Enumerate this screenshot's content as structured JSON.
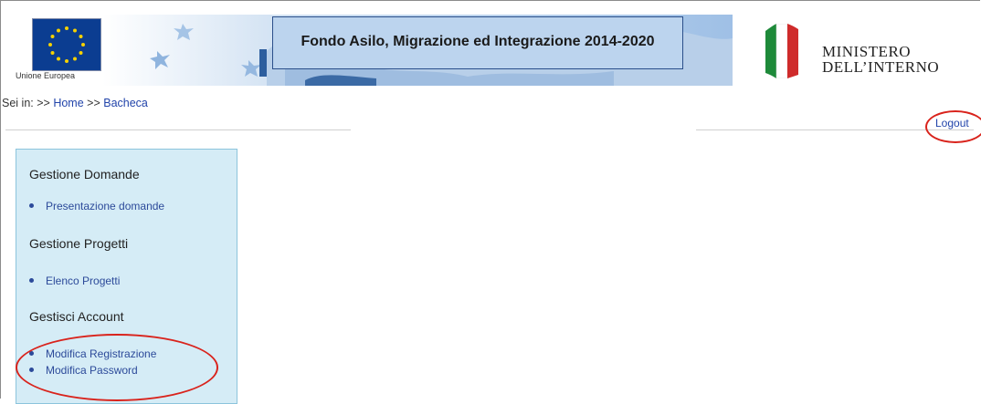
{
  "header": {
    "eu_label": "Unione Europea",
    "title": "Fondo Asilo, Migrazione ed Integrazione 2014-2020",
    "ministry_line1": "MINISTERO",
    "ministry_line2": "DELL’INTERNO"
  },
  "breadcrumb": {
    "prefix": "Sei in: >>",
    "home": "Home",
    "sep": ">>",
    "current": "Bacheca"
  },
  "logout_label": "Logout",
  "sidebar": {
    "sections": [
      {
        "title": "Gestione Domande",
        "items": [
          "Presentazione domande"
        ]
      },
      {
        "title": "Gestione Progetti",
        "items": [
          "Elenco Progetti"
        ]
      },
      {
        "title": "Gestisci Account",
        "items": [
          "Modifica Registrazione",
          "Modifica Password"
        ]
      }
    ]
  },
  "colors": {
    "link": "#2244aa",
    "sidebar_bg": "#d5ecf6",
    "annotation": "#d9231c",
    "eu_blue": "#0b3d91"
  }
}
